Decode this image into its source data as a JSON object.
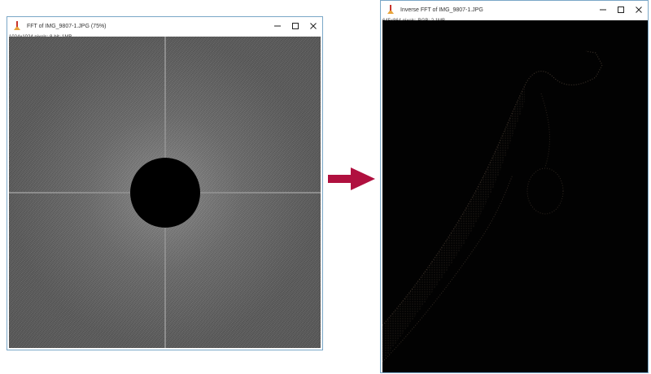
{
  "fft_window": {
    "title": "FFT of IMG_9807-1.JPG (75%)",
    "info": "1024x1024 pixels; 8-bit; 1MB"
  },
  "inverse_window": {
    "title": "Inverse FFT of IMG_9807-1.JPG",
    "info": "645x864 pixels; RGB; 2.1MB"
  },
  "window_controls": {
    "minimize_icon": "minimize-icon",
    "maximize_icon": "maximize-icon",
    "close_icon": "close-icon"
  },
  "colors": {
    "window_border": "#7aa7c7",
    "arrow": "#b0103f",
    "mask": "#000000"
  }
}
